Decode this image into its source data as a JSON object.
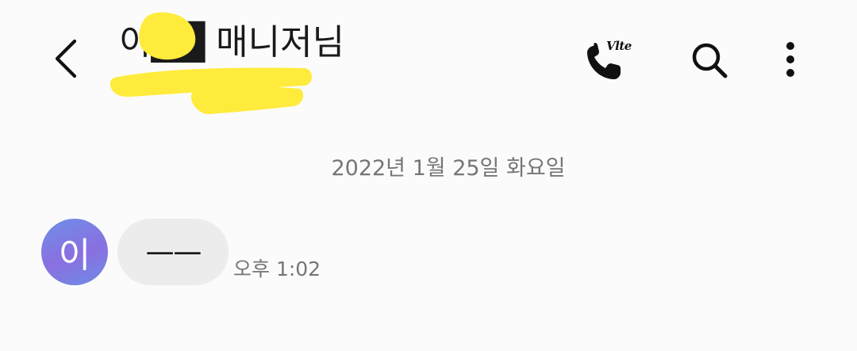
{
  "header": {
    "title": "이██ 매니저님",
    "volte_label": "Vlte"
  },
  "conversation": {
    "date_divider": "2022년 1월 25일 화요일",
    "messages": [
      {
        "avatar_initial": "이",
        "text": "ㅡㅡ",
        "time": "오후 1:02"
      }
    ]
  },
  "colors": {
    "background": "#fbfbfb",
    "bubble": "#ececec",
    "muted_text": "#757575",
    "avatar_gradient_start": "#6e8fe8",
    "avatar_gradient_mid": "#8a6fe0",
    "redaction": "#ffeb3b"
  },
  "icons": {
    "back": "chevron-left-icon",
    "call": "phone-volte-icon",
    "search": "search-icon",
    "more": "more-vertical-icon"
  }
}
